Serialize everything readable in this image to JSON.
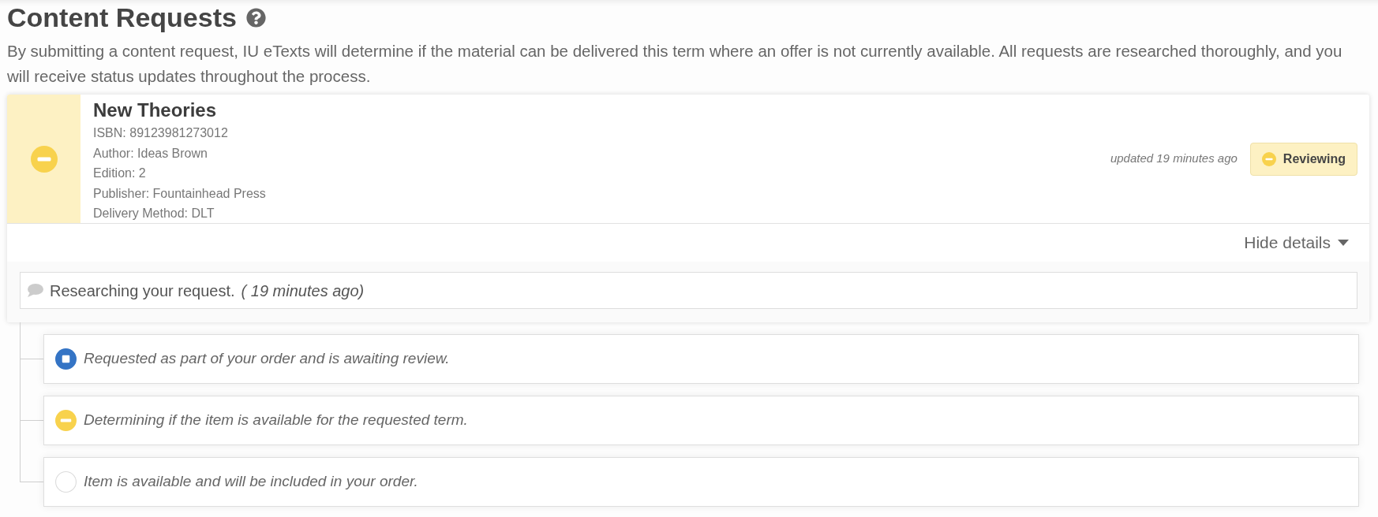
{
  "page": {
    "title": "Content Requests",
    "description": "By submitting a content request, IU eTexts will determine if the material can be delivered this term where an offer is not currently available. All requests are researched thoroughly, and you will receive status updates throughout the process."
  },
  "request": {
    "kind": "reviewing",
    "title": "New Theories",
    "details": [
      "ISBN: 89123981273012",
      "Author: Ideas Brown",
      "Edition: 2",
      "Publisher: Fountainhead Press",
      "Delivery Method: DLT"
    ],
    "updated": "updated 19 minutes ago",
    "badge": "Reviewing",
    "details_toggle": {
      "label": "Hide details",
      "expanded": true
    },
    "comments": [
      {
        "text": "Researching your request.",
        "time": "( 19 minutes ago)"
      }
    ]
  },
  "timeline": [
    {
      "kind": "done",
      "text": "Requested as part of your order and is awaiting review."
    },
    {
      "kind": "active",
      "text": "Determining if the item is available for the requested term."
    },
    {
      "kind": "pending",
      "text": "Item is available and will be included in your order."
    }
  ]
}
